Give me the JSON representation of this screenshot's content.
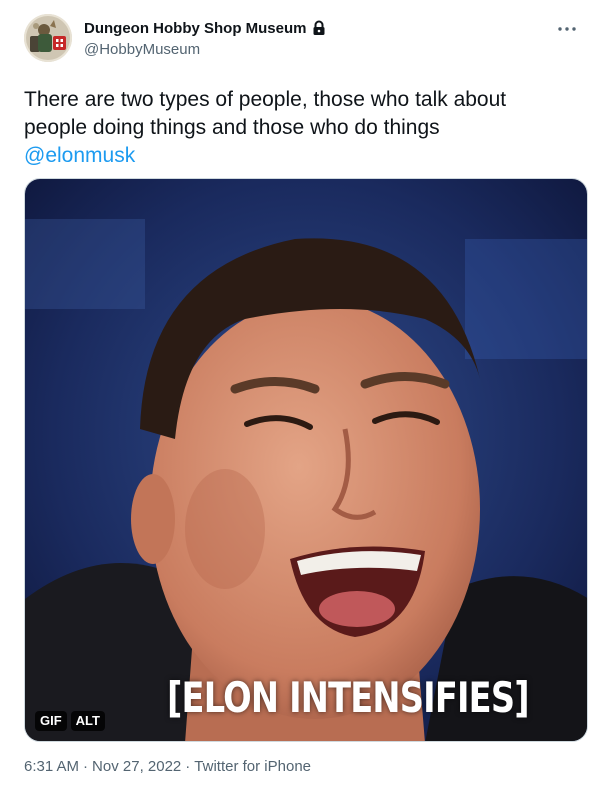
{
  "author": {
    "display_name": "Dungeon Hobby Shop Museum",
    "handle": "@HobbyMuseum",
    "protected_icon": "lock-icon",
    "avatar_icon": "avatar-mascot-image"
  },
  "menu": {
    "icon": "more-icon"
  },
  "tweet": {
    "text_line_1": "There are two types of people, those who talk about",
    "text_line_2": "people doing things and those who do things",
    "mention": "@elonmusk"
  },
  "media": {
    "caption": "[ELON INTENSIFIES]",
    "gif_badge": "GIF",
    "alt_badge": "ALT"
  },
  "footer": {
    "time": "6:31 AM",
    "separator": "·",
    "date": "Nov 27, 2022",
    "source": "Twitter for iPhone"
  },
  "colors": {
    "link": "#1d9bf0",
    "secondary_text": "#536471",
    "primary_text": "#0f1419"
  }
}
